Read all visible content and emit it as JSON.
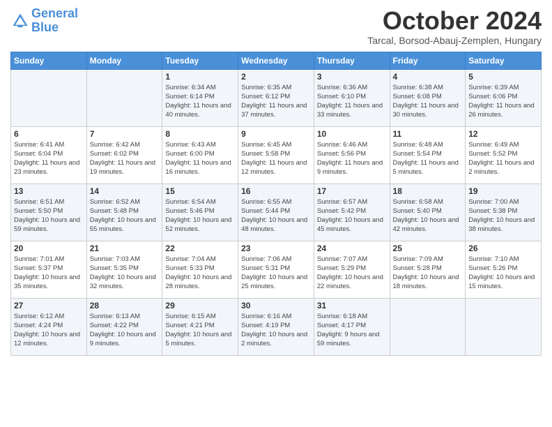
{
  "header": {
    "logo_line1": "General",
    "logo_line2": "Blue",
    "title": "October 2024",
    "subtitle": "Tarcal, Borsod-Abauj-Zemplen, Hungary"
  },
  "days_of_week": [
    "Sunday",
    "Monday",
    "Tuesday",
    "Wednesday",
    "Thursday",
    "Friday",
    "Saturday"
  ],
  "weeks": [
    [
      {
        "day": "",
        "info": ""
      },
      {
        "day": "",
        "info": ""
      },
      {
        "day": "1",
        "info": "Sunrise: 6:34 AM\nSunset: 6:14 PM\nDaylight: 11 hours and 40 minutes."
      },
      {
        "day": "2",
        "info": "Sunrise: 6:35 AM\nSunset: 6:12 PM\nDaylight: 11 hours and 37 minutes."
      },
      {
        "day": "3",
        "info": "Sunrise: 6:36 AM\nSunset: 6:10 PM\nDaylight: 11 hours and 33 minutes."
      },
      {
        "day": "4",
        "info": "Sunrise: 6:38 AM\nSunset: 6:08 PM\nDaylight: 11 hours and 30 minutes."
      },
      {
        "day": "5",
        "info": "Sunrise: 6:39 AM\nSunset: 6:06 PM\nDaylight: 11 hours and 26 minutes."
      }
    ],
    [
      {
        "day": "6",
        "info": "Sunrise: 6:41 AM\nSunset: 6:04 PM\nDaylight: 11 hours and 23 minutes."
      },
      {
        "day": "7",
        "info": "Sunrise: 6:42 AM\nSunset: 6:02 PM\nDaylight: 11 hours and 19 minutes."
      },
      {
        "day": "8",
        "info": "Sunrise: 6:43 AM\nSunset: 6:00 PM\nDaylight: 11 hours and 16 minutes."
      },
      {
        "day": "9",
        "info": "Sunrise: 6:45 AM\nSunset: 5:58 PM\nDaylight: 11 hours and 12 minutes."
      },
      {
        "day": "10",
        "info": "Sunrise: 6:46 AM\nSunset: 5:56 PM\nDaylight: 11 hours and 9 minutes."
      },
      {
        "day": "11",
        "info": "Sunrise: 6:48 AM\nSunset: 5:54 PM\nDaylight: 11 hours and 5 minutes."
      },
      {
        "day": "12",
        "info": "Sunrise: 6:49 AM\nSunset: 5:52 PM\nDaylight: 11 hours and 2 minutes."
      }
    ],
    [
      {
        "day": "13",
        "info": "Sunrise: 6:51 AM\nSunset: 5:50 PM\nDaylight: 10 hours and 59 minutes."
      },
      {
        "day": "14",
        "info": "Sunrise: 6:52 AM\nSunset: 5:48 PM\nDaylight: 10 hours and 55 minutes."
      },
      {
        "day": "15",
        "info": "Sunrise: 6:54 AM\nSunset: 5:46 PM\nDaylight: 10 hours and 52 minutes."
      },
      {
        "day": "16",
        "info": "Sunrise: 6:55 AM\nSunset: 5:44 PM\nDaylight: 10 hours and 48 minutes."
      },
      {
        "day": "17",
        "info": "Sunrise: 6:57 AM\nSunset: 5:42 PM\nDaylight: 10 hours and 45 minutes."
      },
      {
        "day": "18",
        "info": "Sunrise: 6:58 AM\nSunset: 5:40 PM\nDaylight: 10 hours and 42 minutes."
      },
      {
        "day": "19",
        "info": "Sunrise: 7:00 AM\nSunset: 5:38 PM\nDaylight: 10 hours and 38 minutes."
      }
    ],
    [
      {
        "day": "20",
        "info": "Sunrise: 7:01 AM\nSunset: 5:37 PM\nDaylight: 10 hours and 35 minutes."
      },
      {
        "day": "21",
        "info": "Sunrise: 7:03 AM\nSunset: 5:35 PM\nDaylight: 10 hours and 32 minutes."
      },
      {
        "day": "22",
        "info": "Sunrise: 7:04 AM\nSunset: 5:33 PM\nDaylight: 10 hours and 28 minutes."
      },
      {
        "day": "23",
        "info": "Sunrise: 7:06 AM\nSunset: 5:31 PM\nDaylight: 10 hours and 25 minutes."
      },
      {
        "day": "24",
        "info": "Sunrise: 7:07 AM\nSunset: 5:29 PM\nDaylight: 10 hours and 22 minutes."
      },
      {
        "day": "25",
        "info": "Sunrise: 7:09 AM\nSunset: 5:28 PM\nDaylight: 10 hours and 18 minutes."
      },
      {
        "day": "26",
        "info": "Sunrise: 7:10 AM\nSunset: 5:26 PM\nDaylight: 10 hours and 15 minutes."
      }
    ],
    [
      {
        "day": "27",
        "info": "Sunrise: 6:12 AM\nSunset: 4:24 PM\nDaylight: 10 hours and 12 minutes."
      },
      {
        "day": "28",
        "info": "Sunrise: 6:13 AM\nSunset: 4:22 PM\nDaylight: 10 hours and 9 minutes."
      },
      {
        "day": "29",
        "info": "Sunrise: 6:15 AM\nSunset: 4:21 PM\nDaylight: 10 hours and 5 minutes."
      },
      {
        "day": "30",
        "info": "Sunrise: 6:16 AM\nSunset: 4:19 PM\nDaylight: 10 hours and 2 minutes."
      },
      {
        "day": "31",
        "info": "Sunrise: 6:18 AM\nSunset: 4:17 PM\nDaylight: 9 hours and 59 minutes."
      },
      {
        "day": "",
        "info": ""
      },
      {
        "day": "",
        "info": ""
      }
    ]
  ]
}
